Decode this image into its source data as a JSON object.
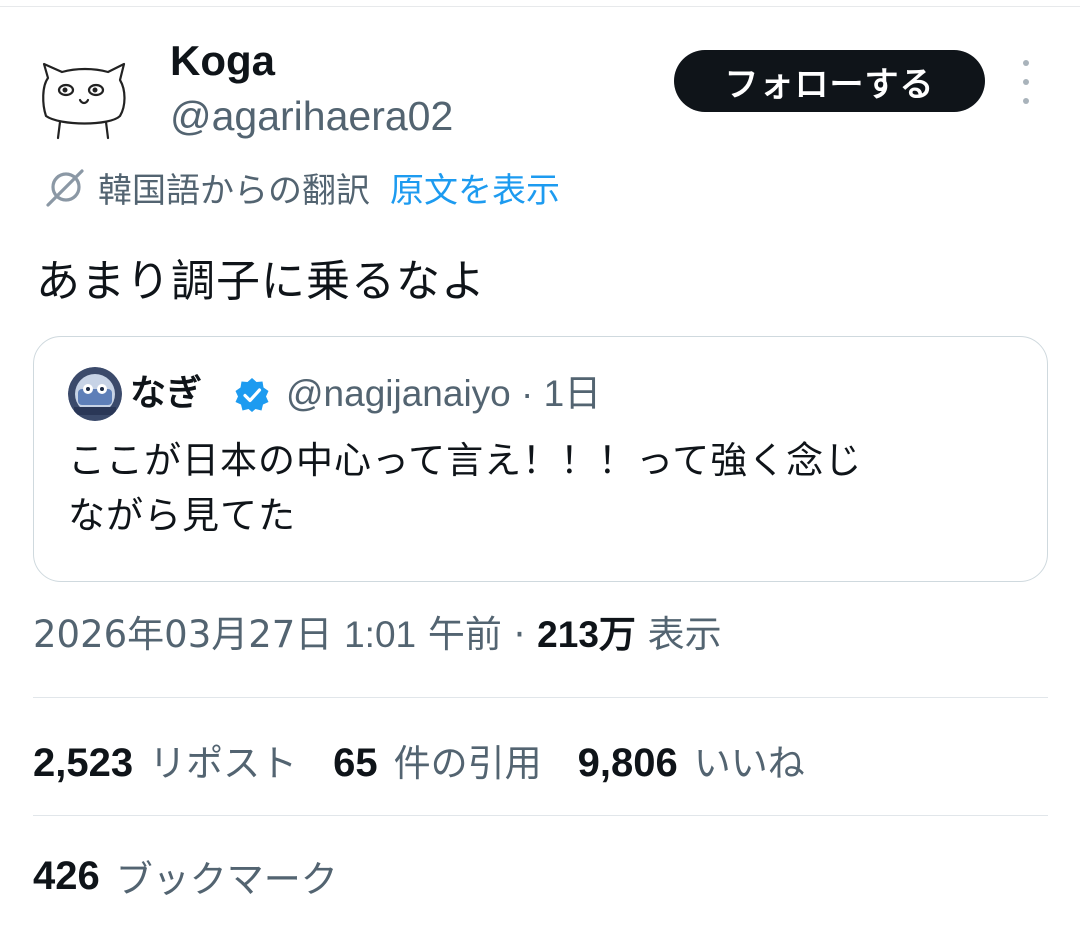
{
  "author": {
    "display_name": "Koga",
    "handle": "@agarihaera02"
  },
  "follow_button_label": "フォローする",
  "translation": {
    "label": "韓国語からの翻訳",
    "show_original_label": "原文を表示"
  },
  "tweet_text": "あまり調子に乗るなよ",
  "quoted_tweet": {
    "display_name": "なぎ",
    "handle_and_time": "@nagijanaiyo · 1日",
    "text_line1": "ここが日本の中心って言え！！！って強く念じ",
    "text_line2": "ながら見てた"
  },
  "timestamp": {
    "date": "2026年03月27日",
    "time": "1:01",
    "ampm": "午前",
    "sep": "·",
    "views_count": "213万",
    "views_label": "表示"
  },
  "stats": {
    "reposts_count": "2,523",
    "reposts_label": "リポスト",
    "quotes_count": "65",
    "quotes_label": "件の引用",
    "likes_count": "9,806",
    "likes_label": "いいね",
    "bookmarks_count": "426",
    "bookmarks_label": "ブックマーク"
  },
  "colors": {
    "accent": "#1d9bf0",
    "text_primary": "#0f1419",
    "text_secondary": "#536471",
    "border": "#cfd9de"
  },
  "icons": {
    "more": "more-vertical-icon",
    "translate": "translate-icon",
    "verified": "verified-badge-icon"
  }
}
